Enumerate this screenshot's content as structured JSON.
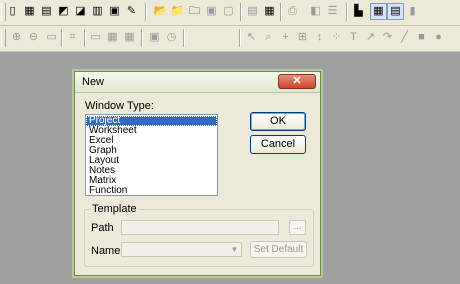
{
  "toolbar1": {
    "buttons": [
      {
        "name": "new-project-icon",
        "glyph": "▯",
        "state": "enabled"
      },
      {
        "name": "new-worksheet-icon",
        "glyph": "▦",
        "state": "enabled"
      },
      {
        "name": "new-excel-icon",
        "glyph": "▤",
        "state": "enabled"
      },
      {
        "name": "new-graph-icon",
        "glyph": "◩",
        "state": "enabled"
      },
      {
        "name": "new-function-icon",
        "glyph": "◪",
        "state": "enabled"
      },
      {
        "name": "new-matrix-icon",
        "glyph": "▥",
        "state": "enabled"
      },
      {
        "name": "new-layout-icon",
        "glyph": "▣",
        "state": "enabled"
      },
      {
        "name": "new-notes-icon",
        "glyph": "✎",
        "state": "enabled"
      },
      {
        "name": "open-icon",
        "glyph": "📂",
        "state": "enabled"
      },
      {
        "name": "open-template-icon",
        "glyph": "📁",
        "state": "enabled"
      },
      {
        "name": "open-excel-icon",
        "glyph": "🗀",
        "state": "enabled"
      },
      {
        "name": "save-project-icon",
        "glyph": "▣",
        "state": "disabled"
      },
      {
        "name": "save-window-icon",
        "glyph": "▢",
        "state": "disabled"
      },
      {
        "name": "import-ascii-icon",
        "glyph": "▤",
        "state": "disabled"
      },
      {
        "name": "import-multiple-icon",
        "glyph": "▦",
        "state": "enabled"
      },
      {
        "name": "print-icon",
        "glyph": "⎙",
        "state": "disabled"
      },
      {
        "name": "duplicate-icon",
        "glyph": "◧",
        "state": "disabled"
      },
      {
        "name": "refresh-icon",
        "glyph": "☰",
        "state": "disabled"
      },
      {
        "name": "project-explorer-icon",
        "glyph": "▙",
        "state": "enabled"
      },
      {
        "name": "results-log-icon",
        "glyph": "▦",
        "state": "pressed"
      },
      {
        "name": "code-builder-icon",
        "glyph": "▤",
        "state": "pressed"
      },
      {
        "name": "command-window-icon",
        "glyph": "▮",
        "state": "disabled"
      }
    ]
  },
  "toolbar2": {
    "buttons": [
      {
        "name": "zoom-in-icon",
        "glyph": "⊕",
        "state": "disabled"
      },
      {
        "name": "zoom-out-icon",
        "glyph": "⊖",
        "state": "disabled"
      },
      {
        "name": "whole-page-icon",
        "glyph": "▭",
        "state": "disabled"
      },
      {
        "name": "rescale-icon",
        "glyph": "⌗",
        "state": "disabled"
      },
      {
        "name": "layer-icon",
        "glyph": "▭",
        "state": "disabled"
      },
      {
        "name": "add-plot-icon",
        "glyph": "▦",
        "state": "disabled"
      },
      {
        "name": "merge-icon",
        "glyph": "▦",
        "state": "disabled"
      },
      {
        "name": "speed-mode-icon",
        "glyph": "▣",
        "state": "disabled"
      },
      {
        "name": "timer-icon",
        "glyph": "◷",
        "state": "disabled"
      },
      {
        "name": "pointer-icon",
        "glyph": "↖",
        "state": "disabled"
      },
      {
        "name": "zoom-tool-icon",
        "glyph": "⌕",
        "state": "disabled"
      },
      {
        "name": "screen-reader-icon",
        "glyph": "+",
        "state": "disabled"
      },
      {
        "name": "data-reader-icon",
        "glyph": "⊞",
        "state": "disabled"
      },
      {
        "name": "data-selector-icon",
        "glyph": "↕",
        "state": "disabled"
      },
      {
        "name": "draw-data-icon",
        "glyph": "⁘",
        "state": "disabled"
      },
      {
        "name": "text-tool-icon",
        "glyph": "T",
        "state": "disabled"
      },
      {
        "name": "arrow-tool-icon",
        "glyph": "↗",
        "state": "disabled"
      },
      {
        "name": "curved-arrow-icon",
        "glyph": "↷",
        "state": "disabled"
      },
      {
        "name": "line-tool-icon",
        "glyph": "╱",
        "state": "disabled"
      },
      {
        "name": "rectangle-tool-icon",
        "glyph": "■",
        "state": "disabled"
      },
      {
        "name": "circle-tool-icon",
        "glyph": "●",
        "state": "disabled"
      }
    ]
  },
  "dialog": {
    "title": "New",
    "close_glyph": "✕",
    "window_type_label": "Window Type:",
    "window_types": [
      "Project",
      "Worksheet",
      "Excel",
      "Graph",
      "Layout",
      "Notes",
      "Matrix",
      "Function"
    ],
    "selected_index": 0,
    "ok_label": "OK",
    "cancel_label": "Cancel",
    "template": {
      "group_label": "Template",
      "path_label": "Path",
      "path_value": "",
      "browse_label": "...",
      "name_label": "Name",
      "name_value": "",
      "dropdown_glyph": "▼",
      "set_default_label": "Set Default"
    }
  }
}
